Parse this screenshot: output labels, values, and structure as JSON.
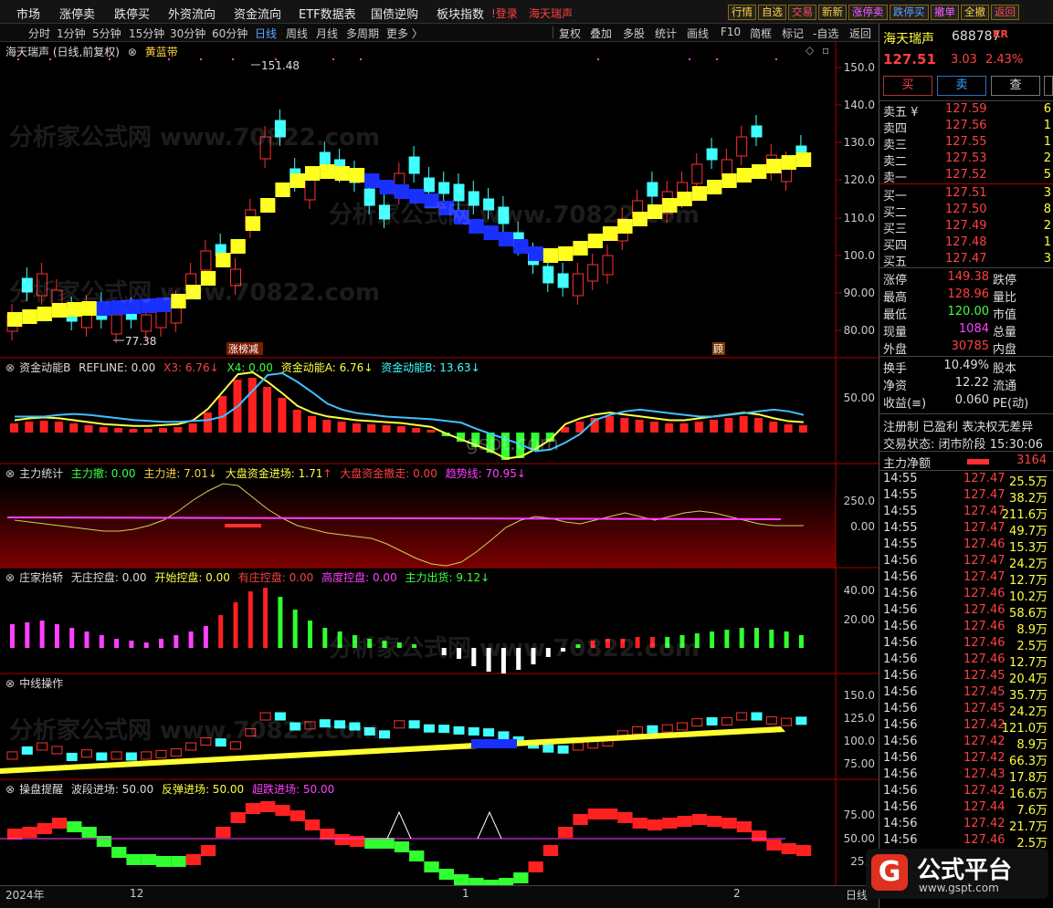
{
  "top_menu": {
    "items": [
      "市场",
      "涨停卖",
      "跌停买",
      "外资流向",
      "资金流向",
      "ETF数据表",
      "国债逆购",
      "板块指数"
    ],
    "login": "!登录",
    "stock_name": "海天瑞声",
    "right_buttons": [
      "行情",
      "自选",
      "交易",
      "新新",
      "涨停卖",
      "跌停买",
      "撤单",
      "全撤",
      "返回"
    ]
  },
  "timeframes": {
    "items": [
      "分时",
      "1分钟",
      "5分钟",
      "15分钟",
      "30分钟",
      "60分钟",
      "日线",
      "周线",
      "月线",
      "多周期",
      "更多 〉"
    ],
    "selected": "日线"
  },
  "toolbar": {
    "items": [
      "复权",
      "叠加",
      "多股",
      "统计",
      "画线",
      "F10",
      "简框",
      "标记",
      "-自选",
      "返回"
    ]
  },
  "main_chart": {
    "title": "海天瑞声 (日线,前复权)",
    "indicator": "黄蓝带",
    "high_label": "151.48",
    "low_label": "77.38",
    "marker_1": "涨榜减",
    "marker_2": "顾",
    "axis": [
      "150.0",
      "140.0",
      "130.0",
      "120.0",
      "110.0",
      "100.0",
      "90.00",
      "80.00"
    ]
  },
  "pane1": {
    "name": "资金动能B",
    "refline": "REFLINE: 0.00",
    "x3": "X3: 6.76",
    "x4": "X4: 0.00",
    "a": "资金动能A: 6.76",
    "b": "资金动能B: 13.63",
    "axis": [
      "50.00"
    ]
  },
  "pane2": {
    "name": "主力统计",
    "sell": "主力撤: 0.00",
    "buy": "主力进: 7.01",
    "big_in": "大盘资金进场: 1.71",
    "big_out": "大盘资金撤走: 0.00",
    "trend": "趋势线: 70.95",
    "axis": [
      "250.0",
      "0.00"
    ]
  },
  "pane3": {
    "name": "庄家抬轿",
    "a": "无庄控盘: 0.00",
    "b": "开始控盘: 0.00",
    "c": "有庄控盘: 0.00",
    "d": "高度控盘: 0.00",
    "e": "主力出货: 9.12",
    "axis": [
      "40.00",
      "20.00"
    ]
  },
  "pane4": {
    "name": "中线操作",
    "axis": [
      "150.0",
      "125.0",
      "100.0",
      "75.00"
    ]
  },
  "pane5": {
    "name": "操盘提醒",
    "a": "波段进场: 50.00",
    "b": "反弹进场: 50.00",
    "c": "超跌进场: 50.00",
    "axis": [
      "75.00",
      "50.00",
      "25.0"
    ]
  },
  "dates": [
    "2024年",
    "12",
    "1",
    "2",
    "日线"
  ],
  "watermark": "分析家公式网 www.70822.com",
  "watermark2": "gspt.com",
  "side": {
    "name": "海天瑞声",
    "code": "688787",
    "kr": "KR",
    "price": "127.51",
    "change": "3.03",
    "pct": "2.43%",
    "buy_btn": "买",
    "sell_btn": "卖",
    "query_btn": "查",
    "asks": [
      {
        "l": "卖五 ¥",
        "p": "127.59",
        "v": "6"
      },
      {
        "l": "卖四",
        "p": "127.56",
        "v": "1"
      },
      {
        "l": "卖三",
        "p": "127.55",
        "v": "1"
      },
      {
        "l": "卖二",
        "p": "127.53",
        "v": "2"
      },
      {
        "l": "卖一",
        "p": "127.52",
        "v": "5"
      }
    ],
    "bids": [
      {
        "l": "买一",
        "p": "127.51",
        "v": "3"
      },
      {
        "l": "买二",
        "p": "127.50",
        "v": "8"
      },
      {
        "l": "买三",
        "p": "127.49",
        "v": "2"
      },
      {
        "l": "买四",
        "p": "127.48",
        "v": "1"
      },
      {
        "l": "买五",
        "p": "127.47",
        "v": "3"
      }
    ],
    "stats": [
      {
        "l": "涨停",
        "v": "149.38",
        "r": "跌停"
      },
      {
        "l": "最高",
        "v": "128.96",
        "r": "量比"
      },
      {
        "l": "最低",
        "v": "120.00",
        "r": "市值"
      },
      {
        "l": "现量",
        "v": "1084",
        "r": "总量"
      },
      {
        "l": "外盘",
        "v": "30785",
        "r": "内盘"
      }
    ],
    "stats2": [
      {
        "l": "换手",
        "v": "10.49%",
        "r": "股本"
      },
      {
        "l": "净资",
        "v": "12.22",
        "r": "流通"
      },
      {
        "l": "收益(≡)",
        "v": "0.060",
        "r": "PE(动)"
      }
    ],
    "flags": "注册制 已盈利 表决权无差异",
    "status_label": "交易状态:",
    "status_value": "闭市阶段",
    "status_time": "15:30:06",
    "net_label": "主力净额",
    "net_value": "3164",
    "ticks": [
      [
        "14:55",
        "127.47",
        "25.5万"
      ],
      [
        "14:55",
        "127.47",
        "38.2万"
      ],
      [
        "14:55",
        "127.47",
        "211.6万"
      ],
      [
        "14:55",
        "127.47",
        "49.7万"
      ],
      [
        "14:55",
        "127.46",
        "15.3万"
      ],
      [
        "14:56",
        "127.47",
        "24.2万"
      ],
      [
        "14:56",
        "127.47",
        "12.7万"
      ],
      [
        "14:56",
        "127.46",
        "10.2万"
      ],
      [
        "14:56",
        "127.46",
        "58.6万"
      ],
      [
        "14:56",
        "127.46",
        "8.9万"
      ],
      [
        "14:56",
        "127.46",
        "2.5万"
      ],
      [
        "14:56",
        "127.46",
        "12.7万"
      ],
      [
        "14:56",
        "127.45",
        "20.4万"
      ],
      [
        "14:56",
        "127.45",
        "35.7万"
      ],
      [
        "14:56",
        "127.45",
        "24.2万"
      ],
      [
        "14:56",
        "127.42",
        "121.0万"
      ],
      [
        "14:56",
        "127.42",
        "8.9万"
      ],
      [
        "14:56",
        "127.42",
        "66.3万"
      ],
      [
        "14:56",
        "127.43",
        "17.8万"
      ],
      [
        "14:56",
        "127.42",
        "16.6万"
      ],
      [
        "14:56",
        "127.44",
        "7.6万"
      ],
      [
        "14:56",
        "127.42",
        "21.7万"
      ],
      [
        "14:56",
        "127.46",
        "2.5万"
      ]
    ]
  },
  "logo": {
    "text": "公式平台",
    "sub": "www.gspt.com"
  }
}
